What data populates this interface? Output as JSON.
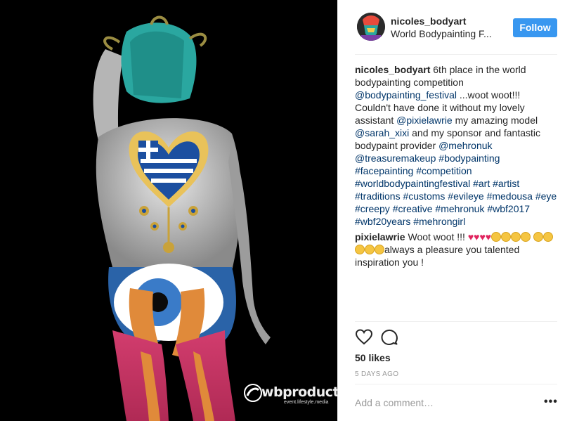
{
  "post": {
    "watermark": {
      "logo_text": "wb",
      "brand": "production",
      "tagline": "event.lifestyle.media"
    }
  },
  "header": {
    "username": "nicoles_bodyart",
    "location": "World Bodypainting F...",
    "follow_label": "Follow"
  },
  "caption": {
    "author": "nicoles_bodyart",
    "text_1": " 6th place in the world bodypainting competition ",
    "mention_1": "@bodypainting_festival",
    "text_2": " ...woot woot!!! Couldn't have done it without my lovely assistant ",
    "mention_2": "@pixielawrie",
    "text_3": " my amazing model ",
    "mention_3": "@sarah_xixi",
    "text_4": " and my sponsor and fantastic bodypaint provider ",
    "mention_4": "@mehronuk",
    "mention_5": "@treasuremakeup",
    "tags": [
      "#bodypainting",
      "#facepainting",
      "#competition",
      "#worldbodypaintingfestival",
      "#art",
      "#artist",
      "#traditions",
      "#customs",
      "#evileye",
      "#medousa",
      "#eye",
      "#creepy",
      "#creative",
      "#mehronuk",
      "#wbf2017",
      "#wbf20years",
      "#mehrongirl"
    ]
  },
  "reply": {
    "author": "pixielawrie",
    "text_1": " Woot woot !!! ",
    "hearts": "♥♥♥♥",
    "text_2": "always a pleasure you talented inspiration you !"
  },
  "actions": {
    "like_icon": "heart-outline-icon",
    "comment_icon": "speech-bubble-icon"
  },
  "likes": "50 likes",
  "time": "5 DAYS AGO",
  "comment_box": {
    "placeholder": "Add a comment…",
    "more_label": "•••"
  }
}
